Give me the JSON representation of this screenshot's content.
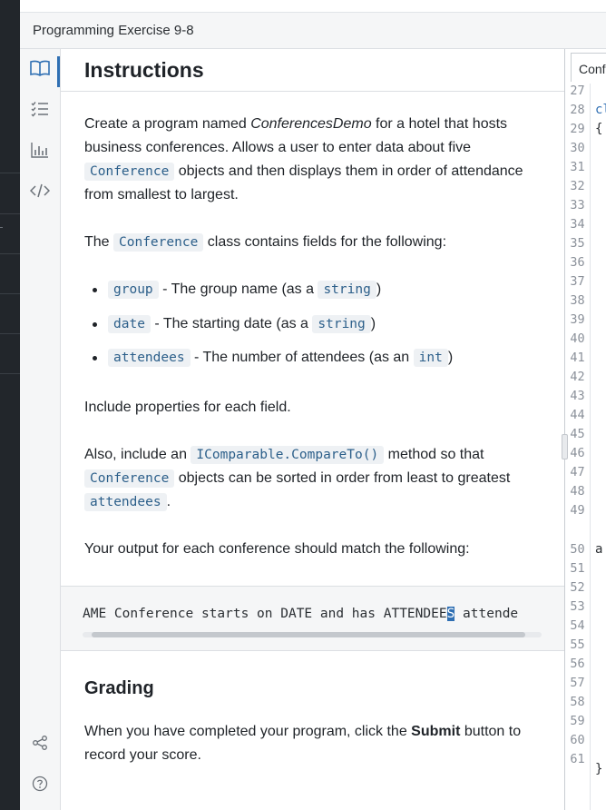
{
  "window": {
    "title": "Programming Exercise 9-8"
  },
  "instructions": {
    "heading": "Instructions",
    "p1": {
      "text_a": "Create a program named ",
      "program_name": "ConferencesDemo",
      "text_b": " for a hotel that hosts business conferences. Allows a user to enter data about five ",
      "code": "Conference",
      "text_c": " objects and then displays them in order of attendance from smallest to largest."
    },
    "p2": {
      "text_a": "The ",
      "code": "Conference",
      "text_b": " class contains fields for the following:"
    },
    "fields": [
      {
        "code": "group",
        "desc": " - The group name (as a ",
        "type": "string",
        "close": ")"
      },
      {
        "code": "date",
        "desc": " - The starting date (as a ",
        "type": "string",
        "close": ")"
      },
      {
        "code": "attendees",
        "desc": " - The number of attendees (as an ",
        "type": "int",
        "close": ")"
      }
    ],
    "p3": "Include properties for each field.",
    "p4": {
      "text_a": "Also, include an ",
      "code_a": "IComparable.CompareTo()",
      "text_b": " method so that ",
      "code_b": "Conference",
      "text_c": " objects can be sorted in order from least to greatest ",
      "code_c": "attendees",
      "text_d": "."
    },
    "p5": "Your output for each conference should match the following:",
    "output_example": {
      "before_cursor": "AME Conference starts on DATE and has ATTENDEE",
      "cursor_char": "S",
      "after_cursor": " attende"
    },
    "grading": {
      "heading": "Grading",
      "text_a": "When you have completed your program, click the ",
      "bold": "Submit",
      "text_b": " button to record your score."
    }
  },
  "sidebar_icons": [
    "book-icon",
    "checklist-icon",
    "bar-chart-icon",
    "code-icon",
    "share-icon",
    "help-icon"
  ],
  "editor": {
    "tab_label": "Conf",
    "line_numbers": [
      "27",
      "28",
      "29",
      "30",
      "31",
      "32",
      "33",
      "34",
      "35",
      "36",
      "37",
      "38",
      "39",
      "40",
      "41",
      "42",
      "43",
      "44",
      "45",
      "46",
      "47",
      "48",
      "49",
      "50",
      "51",
      "52",
      "53",
      "54",
      "55",
      "56",
      "57",
      "58",
      "59",
      "60",
      "61"
    ],
    "fragments": {
      "line28": "cl",
      "line29": "{",
      "wrapped": "a",
      "line60": "}"
    }
  },
  "colors": {
    "accent": "#2f6fb3",
    "code_text": "#2c5f8a",
    "code_bg": "#eef1f4",
    "panel_bg": "#f5f6f7"
  }
}
